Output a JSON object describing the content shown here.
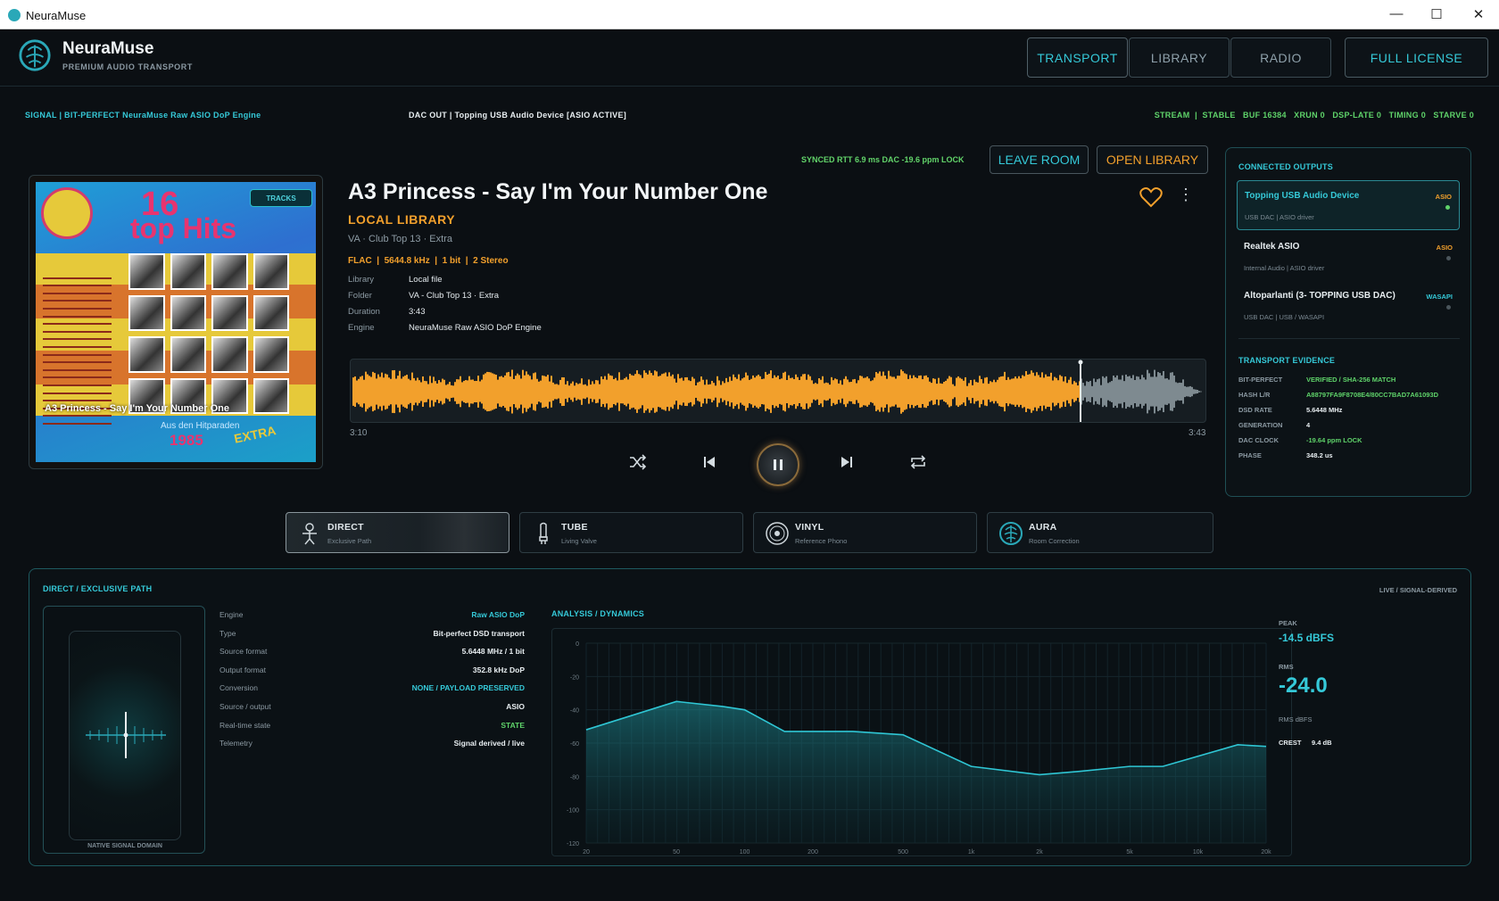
{
  "window": {
    "title": "NeuraMuse",
    "minimize": "—",
    "maximize": "☐",
    "close": "✕"
  },
  "header": {
    "brand": "NeuraMuse",
    "subtitle": "PREMIUM AUDIO TRANSPORT",
    "nav": [
      {
        "label": "TRANSPORT",
        "active": true
      },
      {
        "label": "LIBRARY",
        "active": false
      },
      {
        "label": "RADIO",
        "active": false
      }
    ],
    "license": "FULL LICENSE"
  },
  "status": {
    "signal": "SIGNAL  |  BIT-PERFECT NeuraMuse Raw ASIO DoP Engine",
    "dac": "DAC OUT  |  Topping USB Audio Device  [ASIO ACTIVE]",
    "stream": "STREAM  |  STABLE   BUF 16384   XRUN 0   DSP-LATE 0   TIMING 0   STARVE 0"
  },
  "room": {
    "sync": "SYNCED  RTT 6.9 ms  DAC -19.6 ppm LOCK",
    "leave": "LEAVE ROOM",
    "open_library": "OPEN LIBRARY"
  },
  "album": {
    "tracks_tag": "TRACKS",
    "caption": "A3 Princess - Say I'm Your Number One",
    "cover_top": "16",
    "cover_hits": "top Hits",
    "cover_year": "1985",
    "cover_extra": "EXTRA",
    "cover_bottom": "Aus den Hitparaden"
  },
  "track": {
    "title": "A3 Princess - Say I'm Your Number One",
    "source": "LOCAL LIBRARY",
    "artist": "VA · Club Top 13 · Extra",
    "format": "FLAC  |  5644.8 kHz  |  1 bit  |  2 Stereo",
    "meta": [
      {
        "k": "Library",
        "v": "Local file"
      },
      {
        "k": "Folder",
        "v": "VA - Club Top 13 · Extra"
      },
      {
        "k": "Duration",
        "v": "3:43"
      },
      {
        "k": "Engine",
        "v": "NeuraMuse Raw ASIO DoP Engine"
      }
    ],
    "elapsed": "3:10",
    "total": "3:43",
    "progress": 0.852
  },
  "modes": [
    {
      "name": "DIRECT",
      "sub": "Exclusive Path",
      "active": true
    },
    {
      "name": "TUBE",
      "sub": "Living Valve",
      "active": false
    },
    {
      "name": "VINYL",
      "sub": "Reference Phono",
      "active": false
    },
    {
      "name": "AURA",
      "sub": "Room Correction",
      "active": false
    }
  ],
  "outputs": {
    "title": "CONNECTED OUTPUTS",
    "items": [
      {
        "name": "Topping USB Audio Device",
        "desc": "USB DAC  |  ASIO driver",
        "type": "ASIO",
        "selected": true
      },
      {
        "name": "Realtek ASIO",
        "desc": "Internal Audio  |  ASIO driver",
        "type": "ASIO",
        "selected": false
      },
      {
        "name": "Altoparlanti (3- TOPPING USB DAC)",
        "desc": "USB DAC  |  USB / WASAPI",
        "type": "WASAPI",
        "selected": false
      }
    ]
  },
  "evidence": {
    "title": "TRANSPORT EVIDENCE",
    "rows": [
      {
        "k": "BIT-PERFECT",
        "v": "VERIFIED / SHA-256 MATCH",
        "color": "#5fd36a"
      },
      {
        "k": "HASH L/R",
        "v": "A88797FA9F8708E4/80CC7BAD7A61093D",
        "color": "#5fd36a"
      },
      {
        "k": "DSD RATE",
        "v": "5.6448 MHz",
        "color": "#e8eef1"
      },
      {
        "k": "GENERATION",
        "v": "4",
        "color": "#e8eef1"
      },
      {
        "k": "DAC CLOCK",
        "v": "-19.64 ppm LOCK",
        "color": "#5fd36a"
      },
      {
        "k": "PHASE",
        "v": "348.2 us",
        "color": "#e8eef1"
      }
    ]
  },
  "path": {
    "title": "DIRECT / EXCLUSIVE PATH",
    "live": "LIVE / SIGNAL-DERIVED",
    "viz_label": "NATIVE SIGNAL DOMAIN",
    "rows": [
      {
        "k": "Engine",
        "v": "Raw ASIO DoP",
        "color": "#35c9d8"
      },
      {
        "k": "Type",
        "v": "Bit-perfect DSD transport",
        "color": "#e8eef1"
      },
      {
        "k": "Source format",
        "v": "5.6448 MHz / 1 bit",
        "color": "#e8eef1"
      },
      {
        "k": "Output format",
        "v": "352.8 kHz DoP",
        "color": "#e8eef1"
      },
      {
        "k": "Conversion",
        "v": "NONE / PAYLOAD PRESERVED",
        "color": "#35c9d8"
      },
      {
        "k": "Source / output",
        "v": "ASIO",
        "color": "#e8eef1"
      },
      {
        "k": "Real-time state",
        "v": "STATE",
        "color": "#5fd36a"
      },
      {
        "k": "Telemetry",
        "v": "Signal derived / live",
        "color": "#e8eef1"
      }
    ]
  },
  "analysis": {
    "title": "ANALYSIS / DYNAMICS",
    "peak_label": "PEAK",
    "peak": "-14.5 dBFS",
    "rms_label": "RMS",
    "rms": "-24.0",
    "rms_unit": "RMS dBFS",
    "crest_label": "CREST",
    "crest": "9.4 dB"
  },
  "chart_data": {
    "type": "area",
    "x": [
      "20",
      "50",
      "100",
      "200",
      "500",
      "1k",
      "2k",
      "5k",
      "10k",
      "20k"
    ],
    "y_ticks": [
      "0",
      "-20",
      "-40",
      "-60",
      "-80",
      "-100",
      "-120"
    ],
    "ylim": [
      -120,
      0
    ],
    "series": [
      {
        "values": [
          {
            "x": 20,
            "y": -52
          },
          {
            "x": 50,
            "y": -35
          },
          {
            "x": 80,
            "y": -38
          },
          {
            "x": 100,
            "y": -40
          },
          {
            "x": 150,
            "y": -53
          },
          {
            "x": 200,
            "y": -53
          },
          {
            "x": 300,
            "y": -53
          },
          {
            "x": 500,
            "y": -55
          },
          {
            "x": 1000,
            "y": -74
          },
          {
            "x": 2000,
            "y": -79
          },
          {
            "x": 3000,
            "y": -77
          },
          {
            "x": 5000,
            "y": -74
          },
          {
            "x": 7000,
            "y": -74
          },
          {
            "x": 15000,
            "y": -61
          },
          {
            "x": 20000,
            "y": -62
          }
        ]
      }
    ]
  },
  "colors": {
    "accent": "#35c9d8",
    "orange": "#f2a02c",
    "green": "#5fd36a"
  }
}
